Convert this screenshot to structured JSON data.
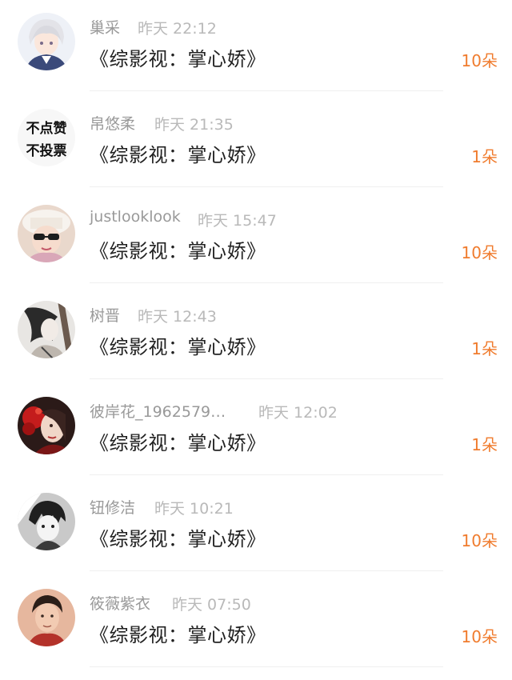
{
  "items": [
    {
      "name": "巢采",
      "time": "昨天 22:12",
      "title": "《综影视：掌心娇》",
      "gift": "10朵",
      "avatar": "anime-white-hair-boy-avatar"
    },
    {
      "name": "帛悠柔",
      "time": "昨天 21:35",
      "title": "《综影视：掌心娇》",
      "gift": "1朵",
      "avatar": "text-avatar",
      "avatar_text": [
        "不点赞",
        "不投票"
      ]
    },
    {
      "name": "justlooklook",
      "time": "昨天 15:47",
      "title": "《综影视：掌心娇》",
      "gift": "10朵",
      "avatar": "girl-in-white-hat-avatar"
    },
    {
      "name": "树晋",
      "time": "昨天 12:43",
      "title": "《综影视：掌心娇》",
      "gift": "1朵",
      "avatar": "ink-drawing-avatar"
    },
    {
      "name": "彼岸花_1962579…",
      "time": "昨天 12:02",
      "title": "《综影视：掌心娇》",
      "gift": "1朵",
      "avatar": "red-flower-woman-avatar"
    },
    {
      "name": "钮修洁",
      "time": "昨天 10:21",
      "title": "《综影视：掌心娇》",
      "gift": "10朵",
      "avatar": "manga-boy-avatar"
    },
    {
      "name": "筱薇紫衣",
      "time": "昨天 07:50",
      "title": "《综影视：掌心娇》",
      "gift": "10朵",
      "avatar": "man-portrait-avatar"
    }
  ],
  "colors": {
    "gift": "#f07c2e",
    "name": "#999999",
    "time": "#b9b9b9",
    "title": "#222222"
  }
}
